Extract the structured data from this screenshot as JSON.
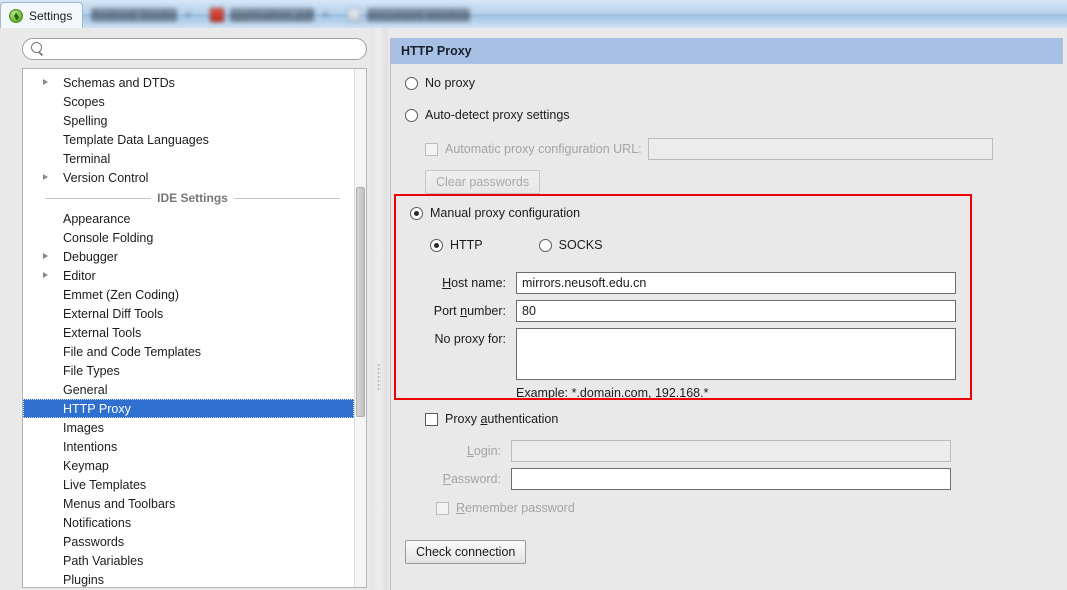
{
  "titlebar": {
    "active_tab": "Settings",
    "app_icon": "android-studio-icon",
    "blurred_tabs": [
      {
        "icon": "blurred-icon",
        "text": "Android Studio"
      },
      {
        "icon": "pdf-icon",
        "text": "application.pdf"
      },
      {
        "icon": "window-icon",
        "text": "document window"
      }
    ],
    "close_glyph": "×"
  },
  "search": {
    "placeholder": "",
    "value": "",
    "icon": "search-icon"
  },
  "tree": {
    "items": [
      {
        "label": "Schemas and DTDs",
        "expandable": true,
        "selected": false
      },
      {
        "label": "Scopes",
        "expandable": false,
        "selected": false
      },
      {
        "label": "Spelling",
        "expandable": false,
        "selected": false
      },
      {
        "label": "Template Data Languages",
        "expandable": false,
        "selected": false
      },
      {
        "label": "Terminal",
        "expandable": false,
        "selected": false
      },
      {
        "label": "Version Control",
        "expandable": true,
        "selected": false
      },
      {
        "separator": "IDE Settings"
      },
      {
        "label": "Appearance",
        "expandable": false,
        "selected": false
      },
      {
        "label": "Console Folding",
        "expandable": false,
        "selected": false
      },
      {
        "label": "Debugger",
        "expandable": true,
        "selected": false
      },
      {
        "label": "Editor",
        "expandable": true,
        "selected": false
      },
      {
        "label": "Emmet (Zen Coding)",
        "expandable": false,
        "selected": false
      },
      {
        "label": "External Diff Tools",
        "expandable": false,
        "selected": false
      },
      {
        "label": "External Tools",
        "expandable": false,
        "selected": false
      },
      {
        "label": "File and Code Templates",
        "expandable": false,
        "selected": false
      },
      {
        "label": "File Types",
        "expandable": false,
        "selected": false
      },
      {
        "label": "General",
        "expandable": false,
        "selected": false
      },
      {
        "label": "HTTP Proxy",
        "expandable": false,
        "selected": true
      },
      {
        "label": "Images",
        "expandable": false,
        "selected": false
      },
      {
        "label": "Intentions",
        "expandable": false,
        "selected": false
      },
      {
        "label": "Keymap",
        "expandable": false,
        "selected": false
      },
      {
        "label": "Live Templates",
        "expandable": false,
        "selected": false
      },
      {
        "label": "Menus and Toolbars",
        "expandable": false,
        "selected": false
      },
      {
        "label": "Notifications",
        "expandable": false,
        "selected": false
      },
      {
        "label": "Passwords",
        "expandable": false,
        "selected": false
      },
      {
        "label": "Path Variables",
        "expandable": false,
        "selected": false
      },
      {
        "label": "Plugins",
        "expandable": false,
        "selected": false
      }
    ]
  },
  "panel": {
    "title": "HTTP Proxy",
    "no_proxy_label": "No proxy",
    "auto_detect_label": "Auto-detect proxy settings",
    "pac_label": "Automatic proxy configuration URL:",
    "pac_value": "",
    "clear_passwords_label": "Clear passwords",
    "manual_label": "Manual proxy configuration",
    "http_label": "HTTP",
    "socks_label": "SOCKS",
    "host_label_pre": "H",
    "host_label_post": "ost name:",
    "host_value": "mirrors.neusoft.edu.cn",
    "port_label_pre": "Port ",
    "port_label_mnem": "n",
    "port_label_post": "umber:",
    "port_value": "80",
    "no_proxy_for_label": "No proxy for:",
    "no_proxy_for_value": "",
    "example_text": "Example: *.domain.com, 192.168.*",
    "proxy_auth_label_pre": "Proxy ",
    "proxy_auth_label_mnem": "a",
    "proxy_auth_label_post": "uthentication",
    "login_label_pre": "L",
    "login_label_post": "ogin:",
    "login_value": "",
    "password_label_pre": "P",
    "password_label_post": "assword:",
    "password_value": "",
    "remember_label_pre": "R",
    "remember_label_post": "emember password",
    "check_connection_label": "Check connection",
    "selected_proxy_mode": "manual",
    "selected_protocol": "HTTP",
    "highlight_color": "#ee0000",
    "header_color": "#a8c0e4",
    "selection_color": "#2f6fd0"
  }
}
